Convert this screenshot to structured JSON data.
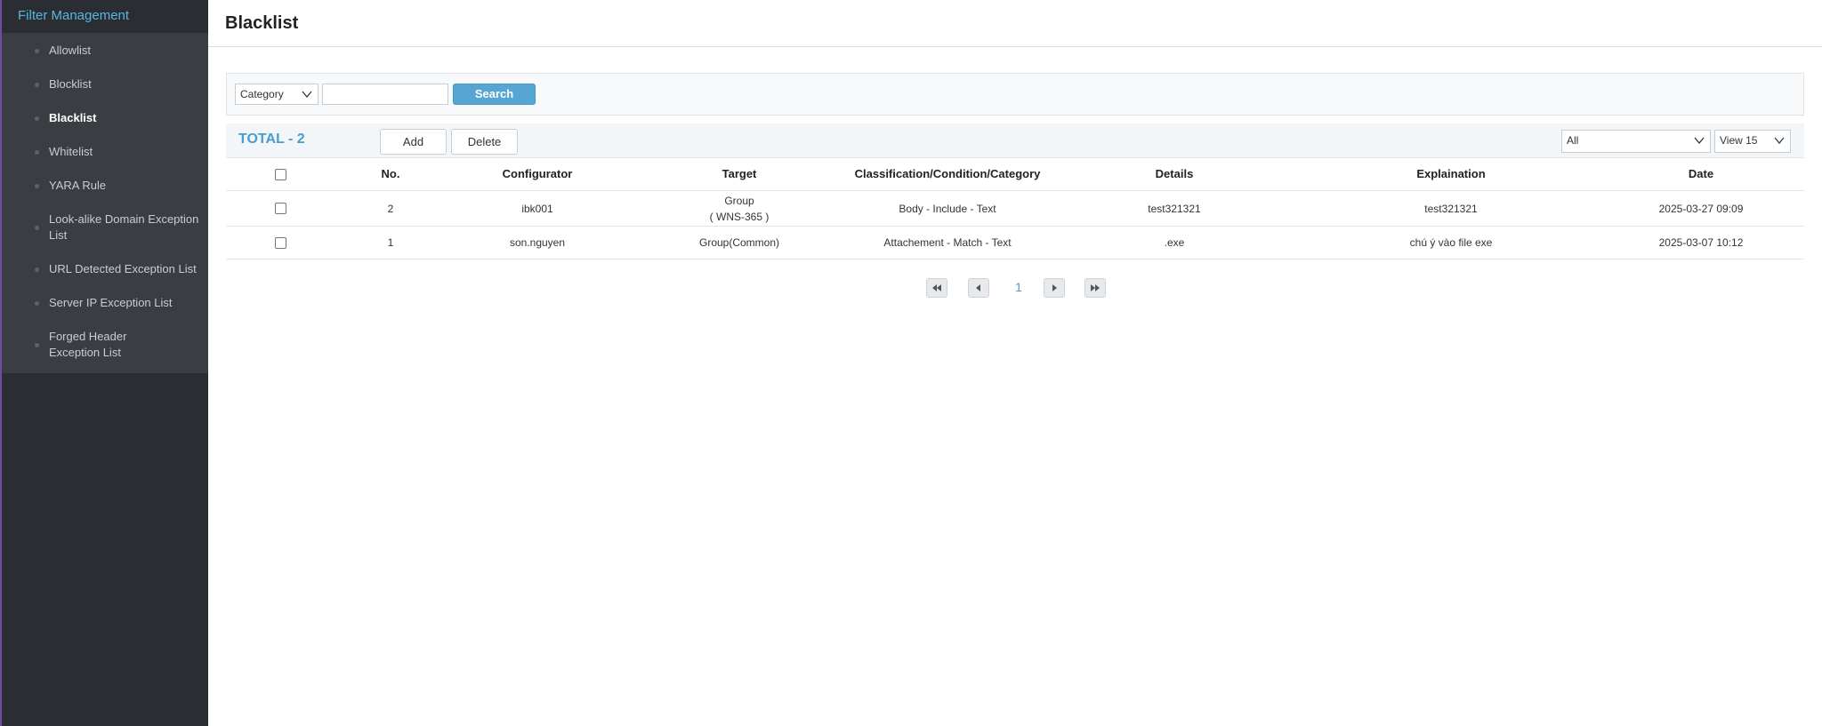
{
  "sidebar": {
    "header": "Filter Management",
    "items": [
      {
        "label": "Allowlist"
      },
      {
        "label": "Blocklist"
      },
      {
        "label": "Blacklist"
      },
      {
        "label": "Whitelist"
      },
      {
        "label": "YARA Rule"
      },
      {
        "label": "Look-alike Domain Exception List"
      },
      {
        "label": "URL Detected Exception List"
      },
      {
        "label": "Server IP Exception List"
      },
      {
        "label": "Forged Header Exception List"
      }
    ],
    "active_item": "Blacklist"
  },
  "page": {
    "title": "Blacklist"
  },
  "search": {
    "category_value": "Category",
    "input_value": "",
    "button_label": "Search"
  },
  "toolbar": {
    "total_label": "TOTAL - 2",
    "add_label": "Add",
    "delete_label": "Delete",
    "filter_value": "All",
    "view_value": "View 15"
  },
  "table": {
    "columns": [
      "No.",
      "Configurator",
      "Target",
      "Classification/Condition/Category",
      "Details",
      "Explaination",
      "Date"
    ],
    "rows": [
      {
        "no": "2",
        "configurator": "ibk001",
        "target_line1": "Group",
        "target_line2": "( WNS-365 )",
        "classification": "Body - Include - Text",
        "details": "test321321",
        "explaination": "test321321",
        "date": "2025-03-27 09:09"
      },
      {
        "no": "1",
        "configurator": "son.nguyen",
        "target_line1": "Group(Common)",
        "classification": "Attachement - Match - Text",
        "details": ".exe",
        "explaination": "chú ý vào file exe",
        "date": "2025-03-07 10:12"
      }
    ]
  },
  "pagination": {
    "current_page": "1"
  },
  "icons": {
    "select_arrow": "chevron-down-icon",
    "first_page": "double-left-arrow-icon",
    "prev_page": "left-arrow-icon",
    "next_page": "right-arrow-icon",
    "last_page": "double-right-arrow-icon"
  },
  "colors": {
    "sidebar_bg": "#2a2e33",
    "submenu_bg": "#3a3e43",
    "accent": "#56a6d1",
    "total_text": "#4a9ccc",
    "header_text": "#5ab5e0"
  }
}
